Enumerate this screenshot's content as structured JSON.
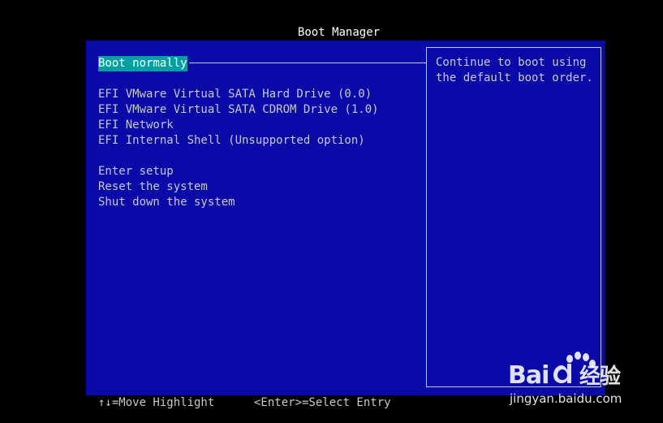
{
  "header": {
    "title": "Boot Manager"
  },
  "menu": {
    "items": [
      {
        "label": "Boot normally",
        "selected": true
      },
      {
        "label": "EFI VMware Virtual SATA Hard Drive (0.0)"
      },
      {
        "label": "EFI VMware Virtual SATA CDROM Drive (1.0)"
      },
      {
        "label": "EFI Network"
      },
      {
        "label": "EFI Internal Shell (Unsupported option)"
      },
      {
        "label": "Enter setup"
      },
      {
        "label": "Reset the system"
      },
      {
        "label": "Shut down the system"
      }
    ]
  },
  "help": {
    "text": "Continue to boot using\nthe default boot order."
  },
  "footer": {
    "move_hint": "↑↓=Move Highlight",
    "select_hint": "<Enter>=Select Entry"
  },
  "watermark": {
    "brand": "Baiдu 经验",
    "url": "jingyan.baidu.com"
  },
  "colors": {
    "background": "#000000",
    "panel": "#0a0aa8",
    "highlight": "#00a0a0",
    "text": "#c8c8c8",
    "title": "#ffffff"
  }
}
